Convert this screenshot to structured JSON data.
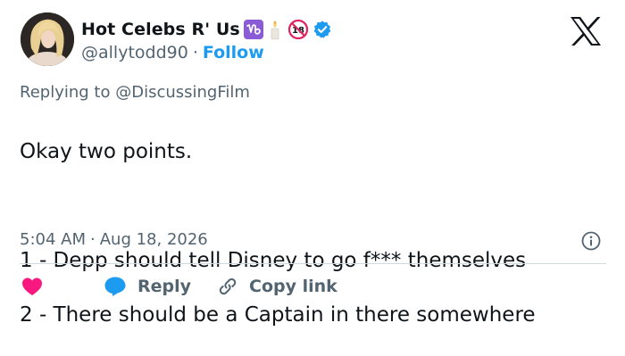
{
  "author": {
    "name": "Hot Celebs R' Us",
    "handle": "@allytodd90",
    "separator": "·",
    "follow_label": "Follow",
    "badges": [
      "capricorn-icon",
      "candle-icon",
      "no-under-18-icon",
      "verified-badge-icon"
    ],
    "no18_text": "18"
  },
  "reply_context": {
    "prefix": "Replying to",
    "mention": "@DiscussingFilm"
  },
  "tweet": {
    "line1": "Okay two points.",
    "line2": "1 - Depp should tell Disney to go f*** themselves",
    "line3": "2 - There should be a Captain in there somewhere"
  },
  "meta": {
    "time": "5:04 AM",
    "separator": "·",
    "date": "Aug 18, 2026"
  },
  "actions": {
    "reply_label": "Reply",
    "copy_link_label": "Copy link"
  },
  "colors": {
    "accent": "#1d9bf0",
    "like": "#f91880",
    "secondary_text": "#536471",
    "capricorn_bg": "#8b5ad6"
  }
}
